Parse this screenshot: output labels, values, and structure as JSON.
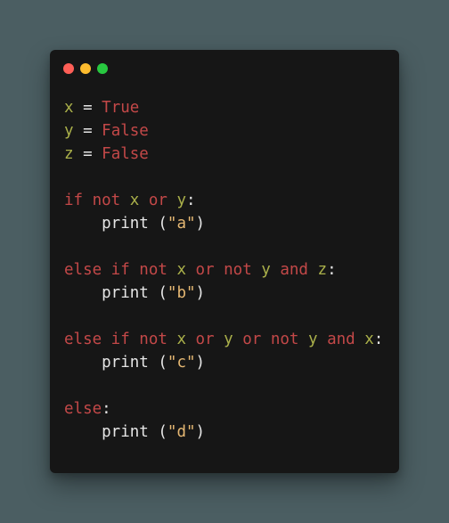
{
  "window": {
    "background": "#161616",
    "page_background": "#4b5e62",
    "controls": [
      {
        "name": "close-button",
        "color": "#fe5f57"
      },
      {
        "name": "minimize-button",
        "color": "#febc2e"
      },
      {
        "name": "zoom-button",
        "color": "#28c840"
      }
    ]
  },
  "colors": {
    "keyword": "#c34848",
    "identifier": "#aab04a",
    "string": "#e6b873",
    "plain": "#e6e6e6"
  },
  "code_lines": [
    [
      {
        "t": "x",
        "c": "id"
      },
      {
        "t": " = ",
        "c": "plain"
      },
      {
        "t": "True",
        "c": "kw"
      }
    ],
    [
      {
        "t": "y",
        "c": "id"
      },
      {
        "t": " = ",
        "c": "plain"
      },
      {
        "t": "False",
        "c": "kw"
      }
    ],
    [
      {
        "t": "z",
        "c": "id"
      },
      {
        "t": " = ",
        "c": "plain"
      },
      {
        "t": "False",
        "c": "kw"
      }
    ],
    [],
    [
      {
        "t": "if not ",
        "c": "kw"
      },
      {
        "t": "x",
        "c": "id"
      },
      {
        "t": " or ",
        "c": "kw"
      },
      {
        "t": "y",
        "c": "id"
      },
      {
        "t": ":",
        "c": "plain"
      }
    ],
    [
      {
        "t": "    print (",
        "c": "plain"
      },
      {
        "t": "\"a\"",
        "c": "str"
      },
      {
        "t": ")",
        "c": "plain"
      }
    ],
    [],
    [
      {
        "t": "else if not ",
        "c": "kw"
      },
      {
        "t": "x",
        "c": "id"
      },
      {
        "t": " or not ",
        "c": "kw"
      },
      {
        "t": "y",
        "c": "id"
      },
      {
        "t": " and ",
        "c": "kw"
      },
      {
        "t": "z",
        "c": "id"
      },
      {
        "t": ":",
        "c": "plain"
      }
    ],
    [
      {
        "t": "    print (",
        "c": "plain"
      },
      {
        "t": "\"b\"",
        "c": "str"
      },
      {
        "t": ")",
        "c": "plain"
      }
    ],
    [],
    [
      {
        "t": "else if not ",
        "c": "kw"
      },
      {
        "t": "x",
        "c": "id"
      },
      {
        "t": " or ",
        "c": "kw"
      },
      {
        "t": "y",
        "c": "id"
      },
      {
        "t": " or not ",
        "c": "kw"
      },
      {
        "t": "y",
        "c": "id"
      },
      {
        "t": " and ",
        "c": "kw"
      },
      {
        "t": "x",
        "c": "id"
      },
      {
        "t": ":",
        "c": "plain"
      }
    ],
    [
      {
        "t": "    print (",
        "c": "plain"
      },
      {
        "t": "\"c\"",
        "c": "str"
      },
      {
        "t": ")",
        "c": "plain"
      }
    ],
    [],
    [
      {
        "t": "else",
        "c": "kw"
      },
      {
        "t": ":",
        "c": "plain"
      }
    ],
    [
      {
        "t": "    print (",
        "c": "plain"
      },
      {
        "t": "\"d\"",
        "c": "str"
      },
      {
        "t": ")",
        "c": "plain"
      }
    ]
  ]
}
